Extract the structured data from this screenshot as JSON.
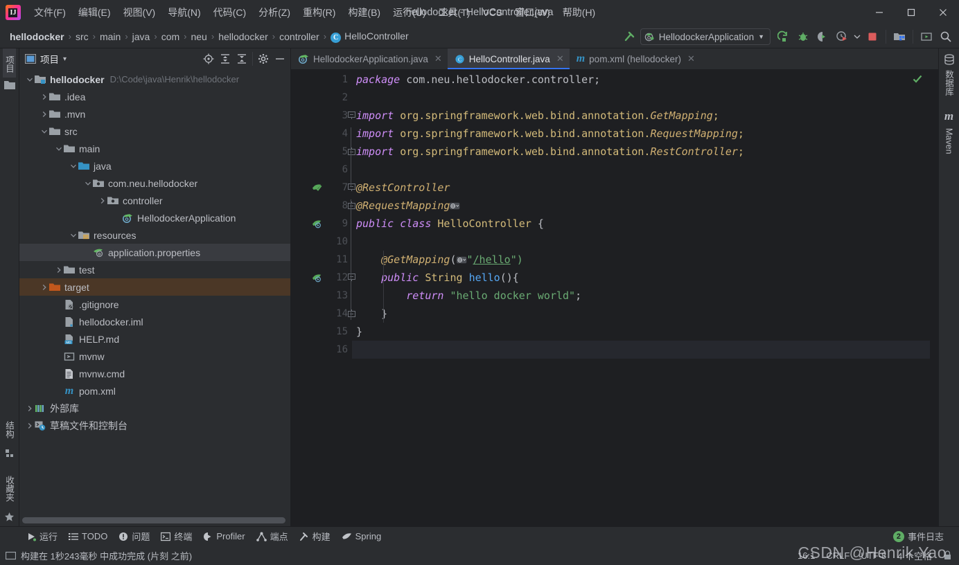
{
  "window": {
    "title": "hellodocker - HelloController.java",
    "minimize_label": "─",
    "maximize_label": "☐",
    "close_label": "✕"
  },
  "menu": {
    "items": [
      {
        "label": "文件(F)",
        "name": "menu-file"
      },
      {
        "label": "编辑(E)",
        "name": "menu-edit"
      },
      {
        "label": "视图(V)",
        "name": "menu-view"
      },
      {
        "label": "导航(N)",
        "name": "menu-navigate"
      },
      {
        "label": "代码(C)",
        "name": "menu-code"
      },
      {
        "label": "分析(Z)",
        "name": "menu-analyze"
      },
      {
        "label": "重构(R)",
        "name": "menu-refactor"
      },
      {
        "label": "构建(B)",
        "name": "menu-build"
      },
      {
        "label": "运行(U)",
        "name": "menu-run"
      },
      {
        "label": "工具(T)",
        "name": "menu-tools"
      },
      {
        "label": "VCS",
        "name": "menu-vcs"
      },
      {
        "label": "窗口(W)",
        "name": "menu-window"
      },
      {
        "label": "帮助(H)",
        "name": "menu-help"
      }
    ]
  },
  "navbar": {
    "crumbs": [
      "hellodocker",
      "src",
      "main",
      "java",
      "com",
      "neu",
      "hellodocker",
      "controller",
      "HelloController"
    ],
    "separator": "›",
    "class_badge": "C",
    "run_config": "HellodockerApplication",
    "dropdown_arrow": "▼"
  },
  "project_panel": {
    "title": "项目",
    "dropdown_arrow": "▾",
    "tree": [
      {
        "label": "hellodocker",
        "path": "D:\\Code\\java\\Henrik\\hellodocker",
        "depth": 0,
        "arrow": "down",
        "icon": "module-folder-icon",
        "bold": true,
        "state": "normal"
      },
      {
        "label": ".idea",
        "path": "",
        "depth": 1,
        "arrow": "right",
        "icon": "folder-icon",
        "bold": false,
        "state": "normal"
      },
      {
        "label": ".mvn",
        "path": "",
        "depth": 1,
        "arrow": "right",
        "icon": "folder-icon",
        "bold": false,
        "state": "normal"
      },
      {
        "label": "src",
        "path": "",
        "depth": 1,
        "arrow": "down",
        "icon": "folder-icon",
        "bold": false,
        "state": "normal"
      },
      {
        "label": "main",
        "path": "",
        "depth": 2,
        "arrow": "down",
        "icon": "folder-icon",
        "bold": false,
        "state": "normal"
      },
      {
        "label": "java",
        "path": "",
        "depth": 3,
        "arrow": "down",
        "icon": "source-root-icon",
        "bold": false,
        "state": "normal"
      },
      {
        "label": "com.neu.hellodocker",
        "path": "",
        "depth": 4,
        "arrow": "down",
        "icon": "package-icon",
        "bold": false,
        "state": "normal"
      },
      {
        "label": "controller",
        "path": "",
        "depth": 5,
        "arrow": "right",
        "icon": "package-icon",
        "bold": false,
        "state": "normal"
      },
      {
        "label": "HellodockerApplication",
        "path": "",
        "depth": 6,
        "arrow": "none",
        "icon": "spring-class-icon",
        "bold": false,
        "state": "normal"
      },
      {
        "label": "resources",
        "path": "",
        "depth": 3,
        "arrow": "down",
        "icon": "resource-root-icon",
        "bold": false,
        "state": "normal"
      },
      {
        "label": "application.properties",
        "path": "",
        "depth": 4,
        "arrow": "none",
        "icon": "spring-properties-icon",
        "bold": false,
        "state": "selected"
      },
      {
        "label": "test",
        "path": "",
        "depth": 2,
        "arrow": "right",
        "icon": "folder-icon",
        "bold": false,
        "state": "normal"
      },
      {
        "label": "target",
        "path": "",
        "depth": 1,
        "arrow": "right",
        "icon": "excluded-folder-icon",
        "bold": false,
        "state": "target"
      },
      {
        "label": ".gitignore",
        "path": "",
        "depth": 2,
        "arrow": "none",
        "icon": "gitignore-file-icon",
        "bold": false,
        "state": "normal"
      },
      {
        "label": "hellodocker.iml",
        "path": "",
        "depth": 2,
        "arrow": "none",
        "icon": "iml-file-icon",
        "bold": false,
        "state": "normal"
      },
      {
        "label": "HELP.md",
        "path": "",
        "depth": 2,
        "arrow": "none",
        "icon": "markdown-file-icon",
        "bold": false,
        "state": "normal"
      },
      {
        "label": "mvnw",
        "path": "",
        "depth": 2,
        "arrow": "none",
        "icon": "shell-script-icon",
        "bold": false,
        "state": "normal"
      },
      {
        "label": "mvnw.cmd",
        "path": "",
        "depth": 2,
        "arrow": "none",
        "icon": "cmd-file-icon",
        "bold": false,
        "state": "normal"
      },
      {
        "label": "pom.xml",
        "path": "",
        "depth": 2,
        "arrow": "none",
        "icon": "maven-file-icon",
        "bold": false,
        "state": "normal"
      },
      {
        "label": "外部库",
        "path": "",
        "depth": 0,
        "arrow": "right",
        "icon": "external-libraries-icon",
        "bold": false,
        "state": "normal"
      },
      {
        "label": "草稿文件和控制台",
        "path": "",
        "depth": 0,
        "arrow": "right",
        "icon": "scratches-icon",
        "bold": false,
        "state": "normal"
      }
    ]
  },
  "left_strip": {
    "top": [
      {
        "label": "项目",
        "name": "tool-window-project",
        "active": true
      }
    ],
    "bottom": [
      {
        "label": "结构",
        "name": "tool-window-structure"
      },
      {
        "label": "收藏夹",
        "name": "tool-window-favorites"
      }
    ]
  },
  "right_strip": {
    "items": [
      {
        "label": "数据库",
        "name": "tool-window-database"
      },
      {
        "label": "Maven",
        "name": "tool-window-maven"
      }
    ]
  },
  "editor": {
    "tabs": [
      {
        "label": "HellodockerApplication.java",
        "icon": "spring-class-icon",
        "active": false,
        "close": "✕"
      },
      {
        "label": "HelloController.java",
        "icon": "java-class-icon",
        "active": true,
        "close": "✕"
      },
      {
        "label": "pom.xml (hellodocker)",
        "icon": "maven-file-icon",
        "active": false,
        "close": "✕"
      }
    ],
    "line_numbers": [
      "1",
      "2",
      "3",
      "4",
      "5",
      "6",
      "7",
      "8",
      "9",
      "10",
      "11",
      "12",
      "13",
      "14",
      "15",
      "16"
    ],
    "current_line": 16,
    "inspection_status": "ok",
    "lines": [
      {
        "n": 1,
        "tokens": [
          {
            "t": "package ",
            "c": "kw"
          },
          {
            "t": "com.neu.hellodocker.controller;",
            "c": "plain"
          }
        ]
      },
      {
        "n": 2,
        "tokens": []
      },
      {
        "n": 3,
        "tokens": [
          {
            "t": "import ",
            "c": "kw"
          },
          {
            "t": "org.springframework.web.bind.annotation.",
            "c": "type"
          },
          {
            "t": "GetMapping",
            "c": "ann"
          },
          {
            "t": ";",
            "c": "type"
          }
        ]
      },
      {
        "n": 4,
        "tokens": [
          {
            "t": "import ",
            "c": "kw"
          },
          {
            "t": "org.springframework.web.bind.annotation.",
            "c": "type"
          },
          {
            "t": "RequestMapping",
            "c": "ann"
          },
          {
            "t": ";",
            "c": "type"
          }
        ]
      },
      {
        "n": 5,
        "tokens": [
          {
            "t": "import ",
            "c": "kw"
          },
          {
            "t": "org.springframework.web.bind.annotation.",
            "c": "type"
          },
          {
            "t": "RestController",
            "c": "ann"
          },
          {
            "t": ";",
            "c": "type"
          }
        ]
      },
      {
        "n": 6,
        "tokens": []
      },
      {
        "n": 7,
        "tokens": [
          {
            "t": "@RestController",
            "c": "ann"
          }
        ]
      },
      {
        "n": 8,
        "tokens": [
          {
            "t": "@RequestMapping",
            "c": "ann"
          },
          {
            "t": "__GLOBE__",
            "c": "globe"
          }
        ]
      },
      {
        "n": 9,
        "tokens": [
          {
            "t": "public class ",
            "c": "kw"
          },
          {
            "t": "HelloController",
            "c": "cls"
          },
          {
            "t": " {",
            "c": "plain"
          }
        ]
      },
      {
        "n": 10,
        "tokens": []
      },
      {
        "n": 11,
        "tokens": [
          {
            "t": "    @GetMapping",
            "c": "ann"
          },
          {
            "t": "(",
            "c": "plain"
          },
          {
            "t": "__GLOBE__",
            "c": "globe"
          },
          {
            "t": "\"",
            "c": "str"
          },
          {
            "t": "/hello",
            "c": "urlstr"
          },
          {
            "t": "\")",
            "c": "str"
          }
        ]
      },
      {
        "n": 12,
        "tokens": [
          {
            "t": "    public ",
            "c": "kw"
          },
          {
            "t": "String ",
            "c": "type"
          },
          {
            "t": "hello",
            "c": "meth"
          },
          {
            "t": "(){",
            "c": "plain"
          }
        ]
      },
      {
        "n": 13,
        "tokens": [
          {
            "t": "        return ",
            "c": "kw"
          },
          {
            "t": "\"hello docker world\"",
            "c": "str"
          },
          {
            "t": ";",
            "c": "plain"
          }
        ]
      },
      {
        "n": 14,
        "tokens": [
          {
            "t": "    }",
            "c": "plain"
          }
        ]
      },
      {
        "n": 15,
        "tokens": [
          {
            "t": "}",
            "c": "plain"
          }
        ]
      },
      {
        "n": 16,
        "tokens": []
      }
    ],
    "gutter_marks": [
      {
        "line": 7,
        "icon": "spring-bean-icon"
      },
      {
        "line": 9,
        "icon": "spring-class-run-icon"
      },
      {
        "line": 12,
        "icon": "spring-endpoint-icon"
      }
    ]
  },
  "bottom_bar": {
    "items": [
      {
        "label": "运行",
        "icon": "run-icon",
        "name": "tool-window-run"
      },
      {
        "label": "TODO",
        "icon": "todo-icon",
        "name": "tool-window-todo"
      },
      {
        "label": "问题",
        "icon": "problems-icon",
        "name": "tool-window-problems"
      },
      {
        "label": "终端",
        "icon": "terminal-icon",
        "name": "tool-window-terminal"
      },
      {
        "label": "Profiler",
        "icon": "profiler-icon",
        "name": "tool-window-profiler"
      },
      {
        "label": "端点",
        "icon": "endpoints-icon",
        "name": "tool-window-endpoints"
      },
      {
        "label": "构建",
        "icon": "build-icon",
        "name": "tool-window-build"
      },
      {
        "label": "Spring",
        "icon": "spring-icon",
        "name": "tool-window-spring"
      }
    ],
    "event_log": {
      "label": "事件日志",
      "count": "2"
    }
  },
  "status_bar": {
    "message": "构建在 1秒243毫秒 中成功完成 (片刻 之前)",
    "caret": "16:1",
    "line_separator": "CRLF",
    "encoding": "UTF-8",
    "indent": "4 个空格",
    "lock": "lock-icon"
  },
  "watermark": "CSDN @Henrik Yao",
  "colors": {
    "bg": "#2b2d30",
    "editor_bg": "#1e1f22",
    "selection": "#393b40",
    "target_highlight": "#4b3726",
    "accent_blue": "#3574f0",
    "green": "#5fad65",
    "keyword": "#cf8ef9",
    "string": "#6aab73",
    "annotation": "#d0b072",
    "method": "#56a8f5"
  }
}
